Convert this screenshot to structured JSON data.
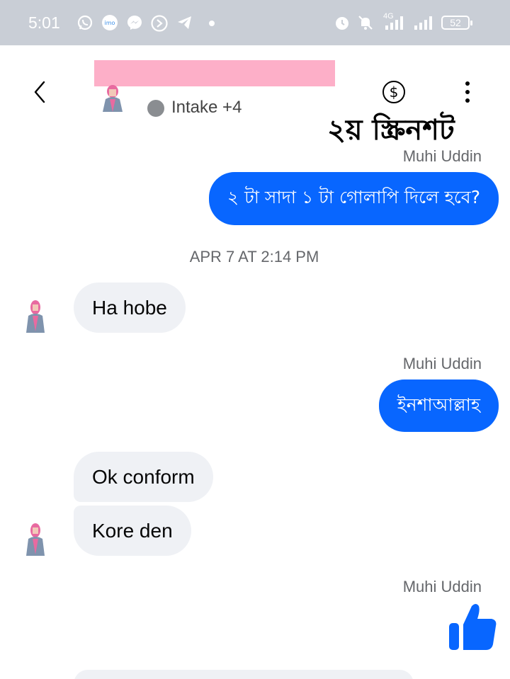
{
  "status_bar": {
    "time": "5:01",
    "network": "4G",
    "battery": "52",
    "icons": [
      "whatsapp-icon",
      "imo-icon",
      "messenger-icon",
      "app-icon",
      "telegram-icon",
      "dot-icon",
      "alarm-icon",
      "mute-icon",
      "signal-icon",
      "signal-icon",
      "battery-icon"
    ]
  },
  "header": {
    "subtitle": "Intake +4",
    "icons": [
      "back-icon",
      "avatar",
      "dollar-icon",
      "more-icon"
    ]
  },
  "watermark": "২য় স্ক্রিনশট",
  "messages": [
    {
      "sender": "Muhi Uddin",
      "text": "২ টা সাদা ১ টা গোলাপি দিলে হবে?",
      "direction": "outgoing"
    },
    {
      "timestamp": "APR 7 AT 2:14 PM"
    },
    {
      "text": "Ha hobe",
      "direction": "incoming"
    },
    {
      "sender": "Muhi Uddin",
      "text": "ইনশাআল্লাহ",
      "direction": "outgoing"
    },
    {
      "text": "Ok conform",
      "direction": "incoming"
    },
    {
      "text": "Kore den",
      "direction": "incoming"
    },
    {
      "sender": "Muhi Uddin",
      "text": "",
      "direction": "outgoing",
      "icon": "thumbs-up-icon"
    }
  ],
  "colors": {
    "status_bar": "#c9ced6",
    "outgoing_bubble": "#0866ff",
    "incoming_bubble": "#eff1f5",
    "name_redaction": "#fdafc8",
    "like": "#0866ff"
  }
}
